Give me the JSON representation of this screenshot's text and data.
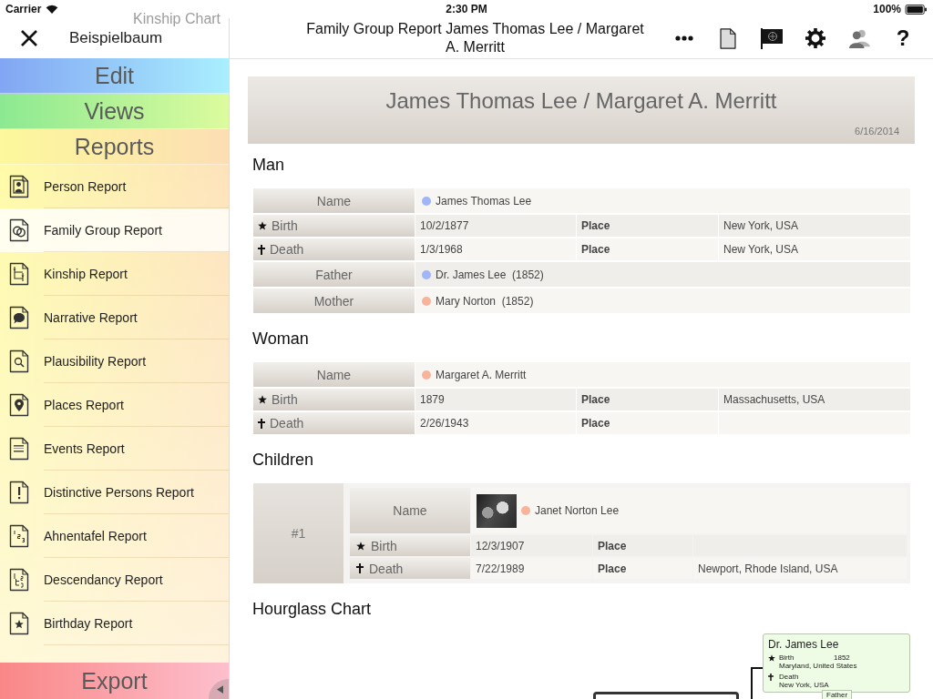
{
  "status_bar": {
    "carrier": "Carrier",
    "time": "2:30 PM",
    "battery": "100%"
  },
  "sidebar": {
    "behind_item": "Kinship Chart",
    "title": "Beispielbaum",
    "sections": [
      {
        "kind": "edit",
        "label": "Edit"
      },
      {
        "kind": "views",
        "label": "Views"
      },
      {
        "kind": "reports",
        "label": "Reports"
      }
    ],
    "items": [
      {
        "kind": "person",
        "label": "Person Report",
        "selected": false
      },
      {
        "kind": "family",
        "label": "Family Group Report",
        "selected": true
      },
      {
        "kind": "kinship",
        "label": "Kinship Report",
        "selected": false
      },
      {
        "kind": "narrative",
        "label": "Narrative Report",
        "selected": false
      },
      {
        "kind": "plausibility",
        "label": "Plausibility Report",
        "selected": false
      },
      {
        "kind": "places",
        "label": "Places Report",
        "selected": false
      },
      {
        "kind": "events",
        "label": "Events Report",
        "selected": false
      },
      {
        "kind": "distinctive",
        "label": "Distinctive Persons Report",
        "selected": false
      },
      {
        "kind": "ahnentafel",
        "label": "Ahnentafel Report",
        "selected": false
      },
      {
        "kind": "descendancy",
        "label": "Descendancy Report",
        "selected": false
      },
      {
        "kind": "birthday",
        "label": "Birthday Report",
        "selected": false
      }
    ],
    "footer": {
      "label": "Export"
    }
  },
  "nav_bar": {
    "title": "Family Group Report James Thomas Lee / Margaret A. Merritt",
    "tools": [
      {
        "kind": "more"
      },
      {
        "kind": "document"
      },
      {
        "kind": "flag"
      },
      {
        "kind": "settings"
      },
      {
        "kind": "persons"
      },
      {
        "kind": "help",
        "label": "?"
      }
    ]
  },
  "report": {
    "title": "James Thomas Lee / Margaret A. Merritt",
    "date": "6/16/2014",
    "sections": [
      {
        "heading": "Man",
        "rows": [
          {
            "kind": "name",
            "label": "Name",
            "value": "James Thomas Lee",
            "color": "#a0b6f6"
          },
          {
            "kind": "birth",
            "label": "Birth",
            "date": "10/2/1877",
            "place_label": "Place",
            "place": "New York, USA"
          },
          {
            "kind": "death",
            "label": "Death",
            "date": "1/3/1968",
            "place_label": "Place",
            "place": "New York, USA"
          },
          {
            "kind": "name",
            "label": "Father",
            "value": "Dr. James Lee  (1852)",
            "color": "#a0b6f6"
          },
          {
            "kind": "name",
            "label": "Mother",
            "value": "Mary Norton  (1852)",
            "color": "#f8b39b"
          }
        ]
      },
      {
        "heading": "Woman",
        "rows": [
          {
            "kind": "name",
            "label": "Name",
            "value": "Margaret A. Merritt",
            "color": "#f8b39b"
          },
          {
            "kind": "birth",
            "label": "Birth",
            "date": "1879",
            "place_label": "Place",
            "place": "Massachusetts, USA"
          },
          {
            "kind": "death",
            "label": "Death",
            "date": "2/26/1943",
            "place_label": "Place"
          }
        ]
      }
    ],
    "children": {
      "heading": "Children",
      "items": [
        {
          "number": "#1",
          "photo": true,
          "rows": [
            {
              "kind": "name",
              "label": "Name",
              "value": "Janet Norton Lee",
              "color": "#f8b39b"
            },
            {
              "kind": "birth",
              "label": "Birth",
              "date": "12/3/1907",
              "place_label": "Place"
            },
            {
              "kind": "death",
              "label": "Death",
              "date": "7/22/1989",
              "place_label": "Place",
              "place": "Newport, Rhode Island, USA"
            }
          ]
        }
      ]
    },
    "hourglass": {
      "heading": "Hourglass Chart",
      "cards": [
        {
          "name": "Dr. James Lee",
          "events": [
            {
              "kind": "birth",
              "label": "Birth",
              "year": "1852",
              "place": "Maryland, United States"
            },
            {
              "kind": "death",
              "label": "Death",
              "place": "New York, USA"
            }
          ],
          "relation": "Father"
        }
      ]
    }
  }
}
